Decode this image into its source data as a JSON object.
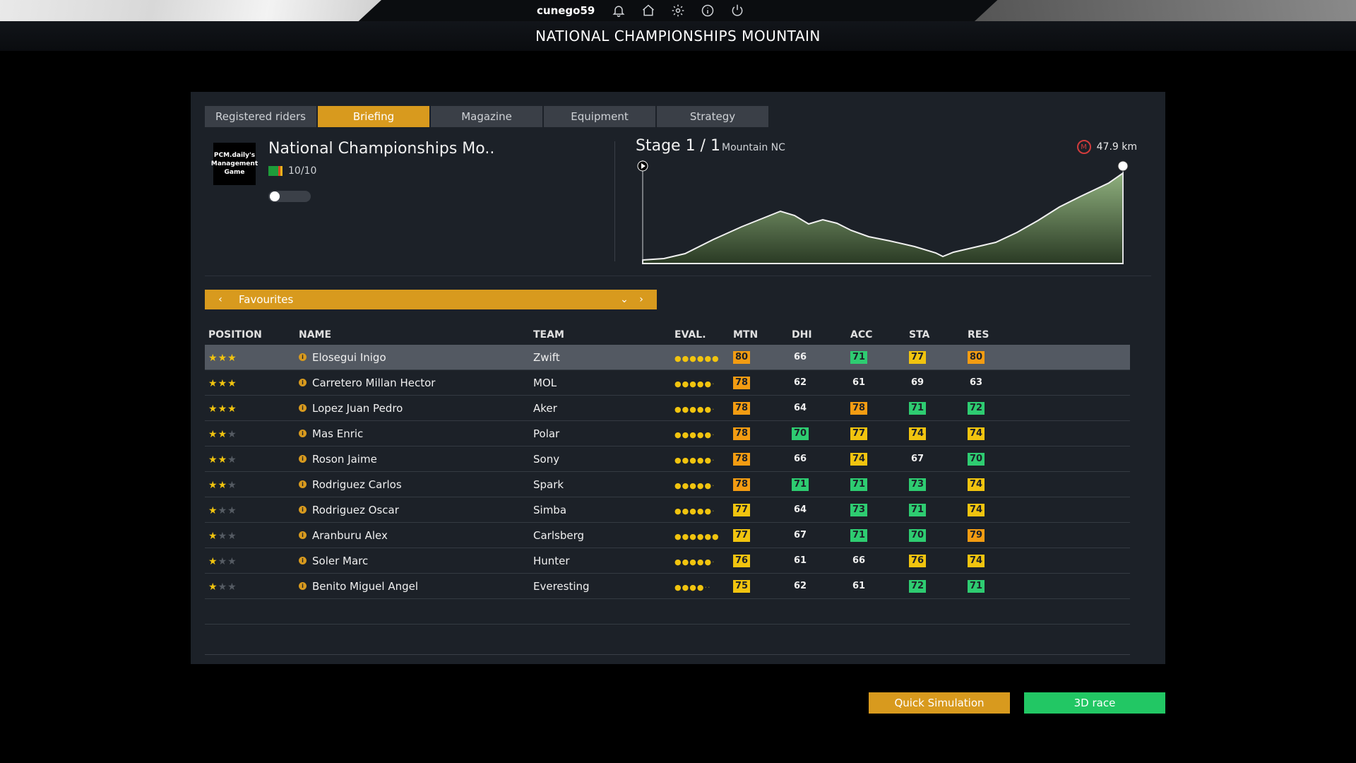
{
  "topbar": {
    "username": "cunego59",
    "icons": [
      "bell-icon",
      "home-icon",
      "gear-icon",
      "info-icon",
      "power-icon"
    ]
  },
  "page_title": "NATIONAL CHAMPIONSHIPS MOUNTAIN",
  "tabs": [
    {
      "label": "Registered riders",
      "active": false
    },
    {
      "label": "Briefing",
      "active": true
    },
    {
      "label": "Magazine",
      "active": false
    },
    {
      "label": "Equipment",
      "active": false
    },
    {
      "label": "Strategy",
      "active": false
    }
  ],
  "race": {
    "logo_text": "PCM.daily's Management Game",
    "name": "National Championships Mo..",
    "rating": "10/10"
  },
  "stage": {
    "title": "Stage 1 / 1",
    "type": "Mountain NC",
    "distance": "47.9 km"
  },
  "favourites": {
    "label": "Favourites"
  },
  "table": {
    "headers": {
      "position": "POSITION",
      "name": "NAME",
      "team": "TEAM",
      "eval": "EVAL.",
      "mtn": "MTN",
      "dhi": "DHI",
      "acc": "ACC",
      "sta": "STA",
      "res": "RES"
    },
    "rows": [
      {
        "stars": 3,
        "name": "Elosegui Inigo",
        "team": "Zwift",
        "eval": 6,
        "mtn": "80",
        "mtn_c": "orange",
        "dhi": "66",
        "dhi_c": "plain",
        "acc": "71",
        "acc_c": "green",
        "sta": "77",
        "sta_c": "yellow",
        "res": "80",
        "res_c": "orange",
        "selected": true
      },
      {
        "stars": 3,
        "name": "Carretero Millan Hector",
        "team": "MOL",
        "eval": 5,
        "mtn": "78",
        "mtn_c": "orange",
        "dhi": "62",
        "dhi_c": "plain",
        "acc": "61",
        "acc_c": "plain",
        "sta": "69",
        "sta_c": "plain",
        "res": "63",
        "res_c": "plain"
      },
      {
        "stars": 3,
        "name": "Lopez Juan Pedro",
        "team": "Aker",
        "eval": 5,
        "mtn": "78",
        "mtn_c": "orange",
        "dhi": "64",
        "dhi_c": "plain",
        "acc": "78",
        "acc_c": "orange",
        "sta": "71",
        "sta_c": "green",
        "res": "72",
        "res_c": "green"
      },
      {
        "stars": 2,
        "name": "Mas Enric",
        "team": "Polar",
        "eval": 5,
        "mtn": "78",
        "mtn_c": "orange",
        "dhi": "70",
        "dhi_c": "green",
        "acc": "77",
        "acc_c": "yellow",
        "sta": "74",
        "sta_c": "yellow",
        "res": "74",
        "res_c": "yellow"
      },
      {
        "stars": 2,
        "name": "Roson Jaime",
        "team": "Sony",
        "eval": 5,
        "mtn": "78",
        "mtn_c": "orange",
        "dhi": "66",
        "dhi_c": "plain",
        "acc": "74",
        "acc_c": "yellow",
        "sta": "67",
        "sta_c": "plain",
        "res": "70",
        "res_c": "green"
      },
      {
        "stars": 2,
        "name": "Rodriguez Carlos",
        "team": "Spark",
        "eval": 5,
        "mtn": "78",
        "mtn_c": "orange",
        "dhi": "71",
        "dhi_c": "green",
        "acc": "71",
        "acc_c": "green",
        "sta": "73",
        "sta_c": "green",
        "res": "74",
        "res_c": "yellow"
      },
      {
        "stars": 1,
        "name": "Rodriguez Oscar",
        "team": "Simba",
        "eval": 5,
        "mtn": "77",
        "mtn_c": "yellow",
        "dhi": "64",
        "dhi_c": "plain",
        "acc": "73",
        "acc_c": "green",
        "sta": "71",
        "sta_c": "green",
        "res": "74",
        "res_c": "yellow"
      },
      {
        "stars": 1,
        "name": "Aranburu Alex",
        "team": "Carlsberg",
        "eval": 6,
        "mtn": "77",
        "mtn_c": "yellow",
        "dhi": "67",
        "dhi_c": "plain",
        "acc": "71",
        "acc_c": "green",
        "sta": "70",
        "sta_c": "green",
        "res": "79",
        "res_c": "orange"
      },
      {
        "stars": 1,
        "name": "Soler Marc",
        "team": "Hunter",
        "eval": 5,
        "mtn": "76",
        "mtn_c": "yellow",
        "dhi": "61",
        "dhi_c": "plain",
        "acc": "66",
        "acc_c": "plain",
        "sta": "76",
        "sta_c": "yellow",
        "res": "74",
        "res_c": "yellow"
      },
      {
        "stars": 1,
        "name": "Benito Miguel Angel",
        "team": "Everesting",
        "eval": 4,
        "mtn": "75",
        "mtn_c": "yellow",
        "dhi": "62",
        "dhi_c": "plain",
        "acc": "61",
        "acc_c": "plain",
        "sta": "72",
        "sta_c": "green",
        "res": "71",
        "res_c": "green"
      }
    ]
  },
  "buttons": {
    "quick_simulation": "Quick Simulation",
    "race_3d": "3D race"
  },
  "colors": {
    "accent": "#d89a1e",
    "green": "#2ecc71",
    "yellow": "#f1c40f",
    "orange": "#f39c12",
    "race_3d": "#22c764"
  }
}
